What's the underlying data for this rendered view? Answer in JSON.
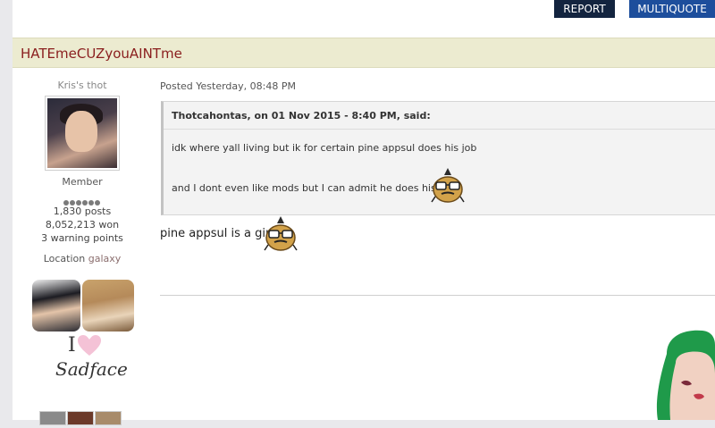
{
  "toolbar": {
    "report_label": "REPORT",
    "multiquote_label": "MULTIQUOTE"
  },
  "post": {
    "author_name": "HATEmeCUZyouAINTme",
    "member_title": "Kris's thot",
    "group": "Member",
    "posts": "1,830 posts",
    "won": "8,052,213 won",
    "warnings": "3 warning points",
    "location_label": "Location",
    "location_value": "galaxy",
    "signature_text_i": "I",
    "signature_text_sad": "Sadface",
    "posted": "Posted Yesterday, 08:48 PM",
    "quote": {
      "header": "Thotcahontas, on 01 Nov 2015 - 8:40 PM, said:",
      "line1": "idk where yall living but ik for certain pine appsul does his job",
      "line2": "and I dont even like mods but I can admit he does his job"
    },
    "reply": "pine appsul is a girl"
  },
  "colors": {
    "report_bg": "#13243f",
    "multiquote_bg": "#1d4e9c",
    "title_bar": "#ecebd0",
    "username": "#8a1e1e"
  },
  "icons": [
    "pineapple-emoticon",
    "heart-icon"
  ]
}
